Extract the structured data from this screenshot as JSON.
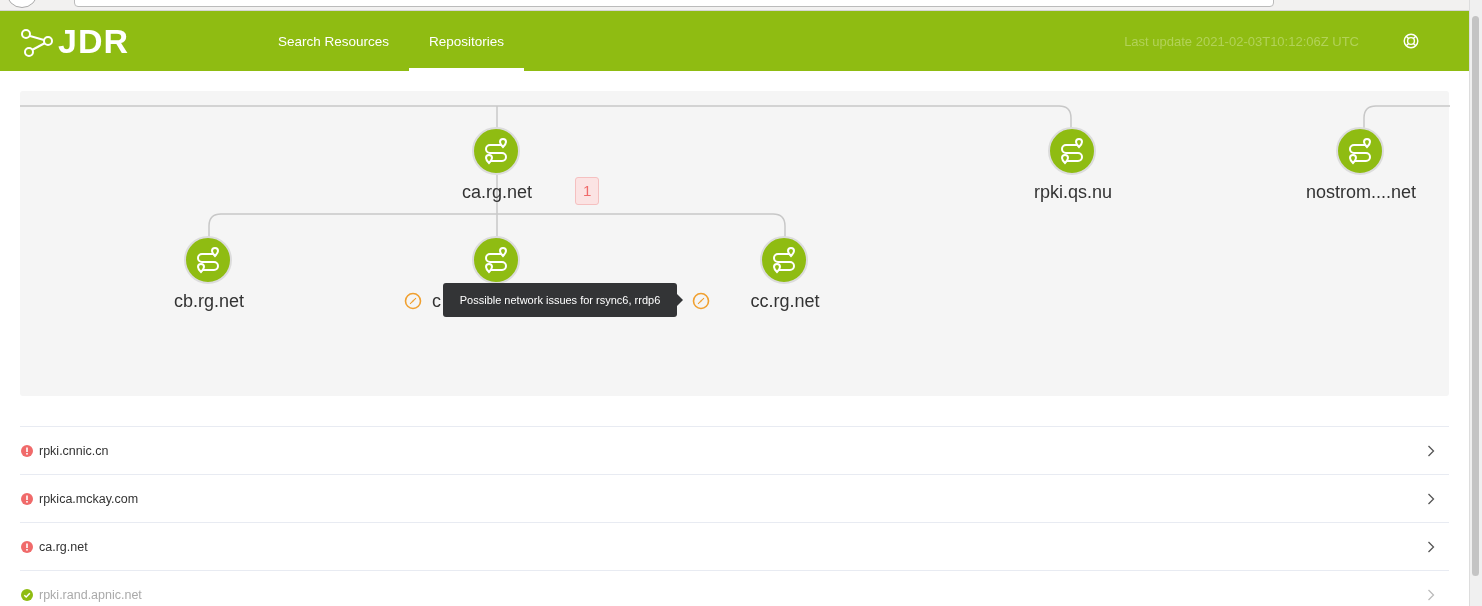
{
  "header": {
    "brand": "JDR",
    "tabs": [
      {
        "label": "Search Resources",
        "selected": false
      },
      {
        "label": "Repositories",
        "selected": true
      }
    ],
    "last_update": "Last update 2021-02-03T10:12:06Z UTC"
  },
  "tree": {
    "roots": [
      {
        "name": "ca.rg.net",
        "badge": "1",
        "children": [
          {
            "name": "cb.rg.net",
            "warning": false
          },
          {
            "name": "c",
            "warning": true,
            "tooltip": "Possible network issues for rsync6, rrdp6"
          },
          {
            "name": "cc.rg.net",
            "warning": false
          }
        ]
      },
      {
        "name": "rpki.qs.nu"
      },
      {
        "name": "nostrom....net"
      }
    ]
  },
  "repositories": [
    {
      "name": "rpki.cnnic.cn",
      "error": true
    },
    {
      "name": "rpkica.mckay.com",
      "error": true
    },
    {
      "name": "ca.rg.net",
      "error": true
    },
    {
      "name": "rpki.rand.apnic.net",
      "error": false
    }
  ]
}
